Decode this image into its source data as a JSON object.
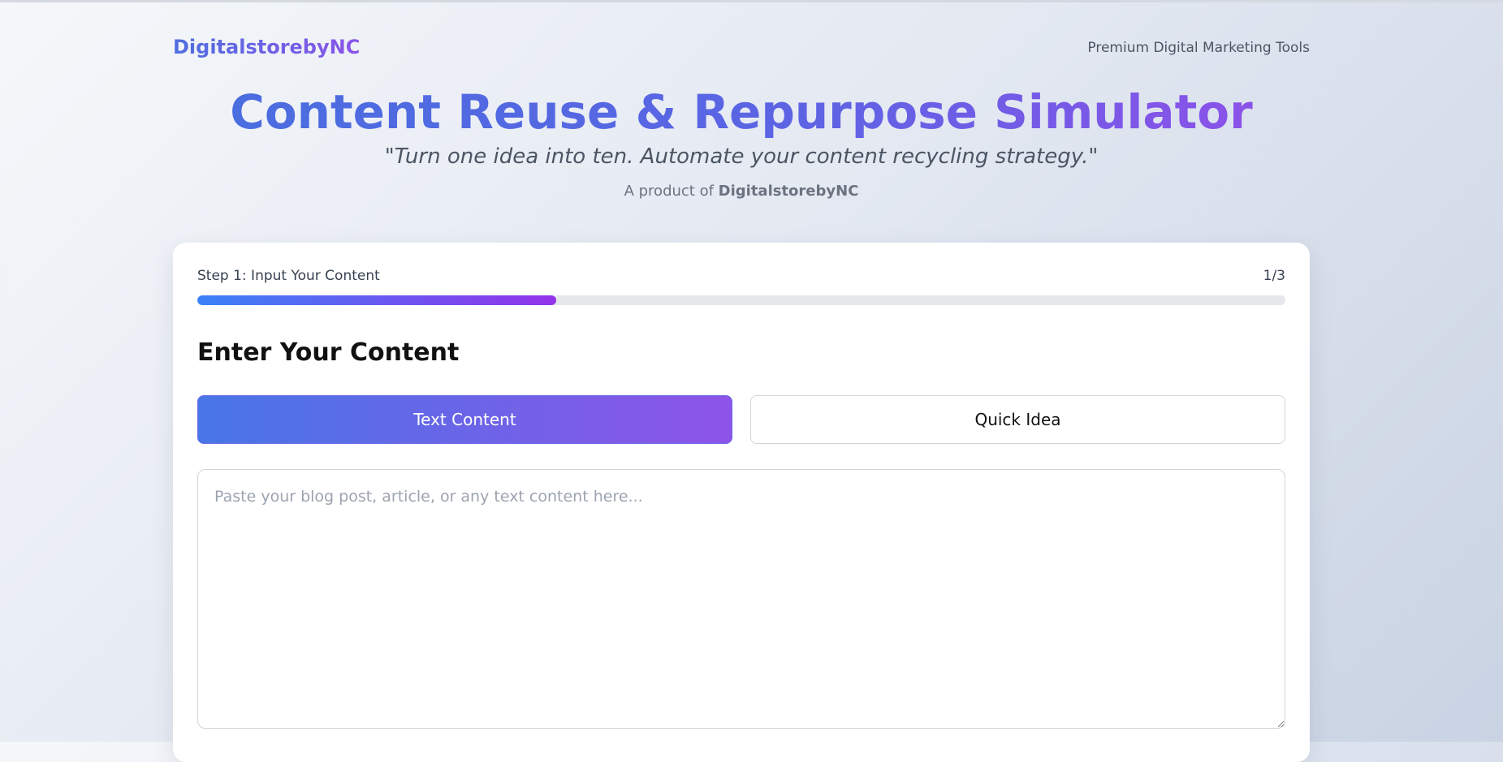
{
  "header": {
    "brand": "DigitalstorebyNC",
    "tagline": "Premium Digital Marketing Tools"
  },
  "hero": {
    "title": "Content Reuse & Repurpose Simulator",
    "quote": "\"Turn one idea into ten. Automate your content recycling strategy.\"",
    "product_prefix": "A product of ",
    "product_brand": "DigitalstorebyNC"
  },
  "wizard": {
    "step_label": "Step 1: Input Your Content",
    "step_count": "1/3",
    "progress_fraction": 0.33,
    "section_title": "Enter Your Content",
    "tabs": [
      {
        "label": "Text Content",
        "active": true
      },
      {
        "label": "Quick Idea",
        "active": false
      }
    ],
    "content_input": {
      "placeholder": "Paste your blog post, article, or any text content here...",
      "value": ""
    }
  },
  "colors": {
    "accent_start": "#4776e6",
    "accent_end": "#8e54e9",
    "progress_start": "#3b82f6",
    "progress_end": "#9333ea"
  }
}
